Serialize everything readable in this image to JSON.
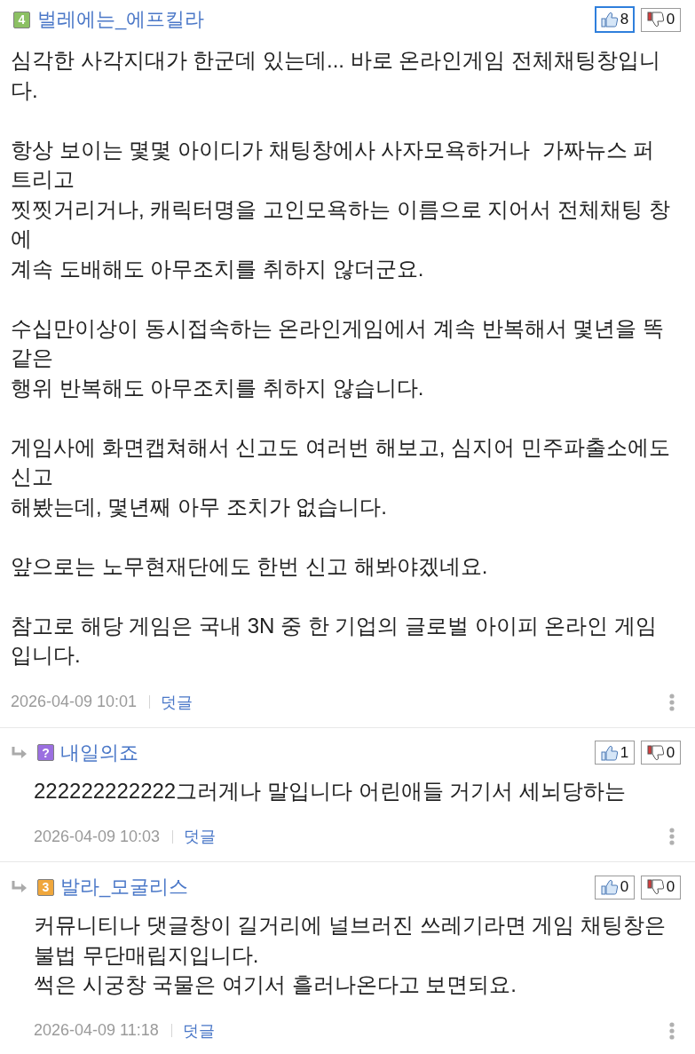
{
  "comments": [
    {
      "kind": "comment",
      "badge": {
        "label": "4",
        "color": "#8cc063"
      },
      "author": "벌레에는_에프킬라",
      "likes": {
        "count": "8",
        "selected": true
      },
      "dislikes": {
        "count": "0",
        "selected": false
      },
      "body": [
        "심각한 사각지대가 한군데 있는데... 바로 온라인게임 전체채팅창입니\n다.",
        "항상 보이는 몇몇 아이디가 채팅창에사 사자모욕하거나  가짜뉴스 퍼\n트리고\n찟찟거리거나, 캐릭터명을 고인모욕하는 이름으로 지어서 전체채팅 창\n에\n계속 도배해도 아무조치를 취하지 않더군요.",
        "수십만이상이 동시접속하는 온라인게임에서 계속 반복해서 몇년을 똑\n같은\n행위 반복해도 아무조치를 취하지 않습니다.",
        "게임사에 화면캡쳐해서 신고도 여러번 해보고, 심지어 민주파출소에도\n신고\n해봤는데, 몇년째 아무 조치가 없습니다.",
        "앞으로는 노무현재단에도 한번 신고 해봐야겠네요.",
        "참고로 해당 게임은 국내 3N 중 한 기업의 글로벌 아이피 온라인 게임\n입니다."
      ],
      "date": "2026-04-09 10:01",
      "reply_link": "덧글"
    },
    {
      "kind": "reply",
      "badge": {
        "label": "?",
        "color": "#9b6fe0"
      },
      "author": "내일의죠",
      "likes": {
        "count": "1",
        "selected": false
      },
      "dislikes": {
        "count": "0",
        "selected": false
      },
      "body": [
        "222222222222그러게나 말입니다 어린애들 거기서 세뇌당하는"
      ],
      "date": "2026-04-09 10:03",
      "reply_link": "덧글"
    },
    {
      "kind": "reply",
      "badge": {
        "label": "3",
        "color": "#f0a73c"
      },
      "author": "발라_모굴리스",
      "likes": {
        "count": "0",
        "selected": false
      },
      "dislikes": {
        "count": "0",
        "selected": false
      },
      "body": [
        "커뮤니티나 댓글창이 길거리에 널브러진 쓰레기라면 게임 채팅창은\n불법 무단매립지입니다.\n썩은 시궁창 국물은 여기서 흘러나온다고 보면되요."
      ],
      "date": "2026-04-09 11:18",
      "reply_link": "덧글"
    }
  ]
}
